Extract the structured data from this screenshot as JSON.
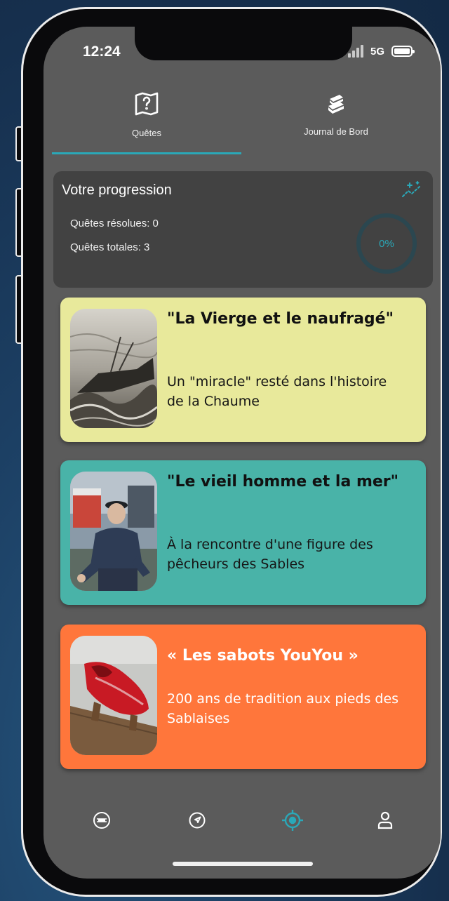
{
  "status_bar": {
    "time": "12:24",
    "network": "5G"
  },
  "tabs": [
    {
      "label": "Quêtes",
      "icon": "map-question-icon",
      "active": true
    },
    {
      "label": "Journal de Bord",
      "icon": "books-icon",
      "active": false
    }
  ],
  "progression": {
    "title": "Votre progression",
    "resolved_text": "Quêtes résolues: 0",
    "total_text": "Quêtes totales: 3",
    "percent_label": "0%",
    "percent": 0,
    "icon": "sparkle-chart-icon"
  },
  "quests": [
    {
      "title": "\"La Vierge et le naufragé\"",
      "description": "Un \"miracle\" resté dans l'histoire de la Chaume",
      "image": "shipwreck-engraving",
      "color": "#e8e99b"
    },
    {
      "title": "\"Le vieil homme et la mer\"",
      "description": "À la rencontre d'une figure des pêcheurs des Sables",
      "image": "old-fisherman-photo",
      "color": "#49b3a8"
    },
    {
      "title": "« Les sabots YouYou »",
      "description": "200 ans de tradition aux pieds des Sablaises",
      "image": "red-clog-photo",
      "color": "#ff763b"
    }
  ],
  "bottom_nav": [
    {
      "icon": "logo-badge-icon",
      "active": false
    },
    {
      "icon": "navigation-arrow-icon",
      "active": false
    },
    {
      "icon": "target-locate-icon",
      "active": true
    },
    {
      "icon": "user-icon",
      "active": false
    }
  ],
  "colors": {
    "accent": "#2aa8b8",
    "screen_bg": "#5b5b5b",
    "card_bg": "#424242"
  }
}
